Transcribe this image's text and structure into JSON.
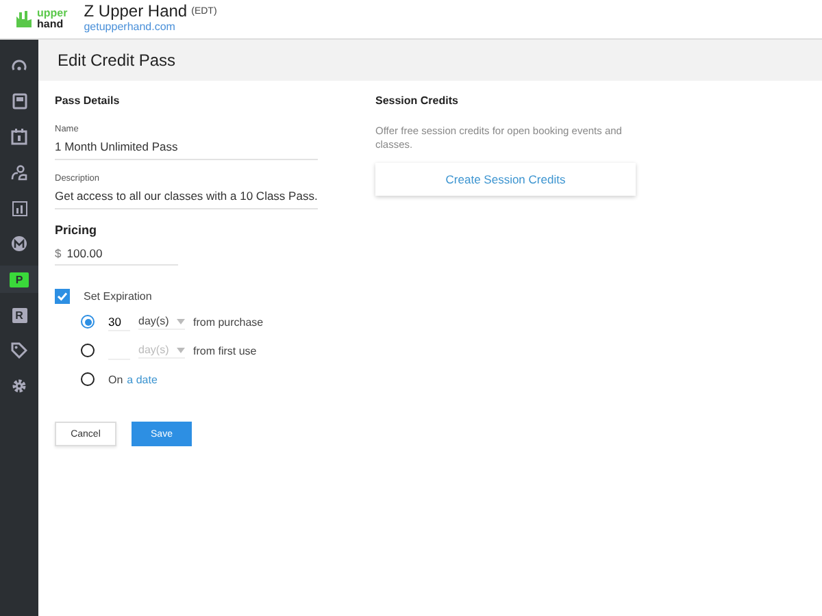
{
  "header": {
    "logo_top": "upper",
    "logo_bottom": "hand",
    "business": "Z Upper Hand",
    "timezone": "(EDT)",
    "site": "getupperhand.com"
  },
  "sidebar": {
    "items": [
      {
        "selected": false
      },
      {
        "selected": false
      },
      {
        "selected": false
      },
      {
        "selected": false
      },
      {
        "selected": false
      },
      {
        "selected": false
      },
      {
        "label": "P",
        "selected": true
      },
      {
        "label": "R",
        "selected": false
      },
      {
        "selected": false
      },
      {
        "selected": false
      }
    ]
  },
  "page_title": "Edit Credit Pass",
  "pass_details": {
    "heading": "Pass Details",
    "name": {
      "label": "Name",
      "value": "1 Month Unlimited Pass"
    },
    "description": {
      "label": "Description",
      "value": "Get access to all our classes with a 10 Class Pass."
    }
  },
  "pricing": {
    "heading": "Pricing",
    "currency": "$",
    "value": "100.00"
  },
  "expiration": {
    "label": "Set Expiration",
    "checked": true,
    "options": [
      {
        "kind": "days",
        "selected": true,
        "value": "30",
        "unit": "day(s)",
        "unit_disabled": false,
        "suffix": "from purchase"
      },
      {
        "kind": "days",
        "selected": false,
        "unit": "day(s)",
        "unit_disabled": true,
        "suffix": "from first use"
      },
      {
        "kind": "date",
        "selected": false,
        "prefix": "On",
        "link": "a date"
      }
    ]
  },
  "session_credits": {
    "heading": "Session Credits",
    "text": "Offer free session credits for open booking events and classes.",
    "button": "Create Session Credits"
  },
  "buttons": {
    "cancel": "Cancel",
    "save": "Save"
  }
}
